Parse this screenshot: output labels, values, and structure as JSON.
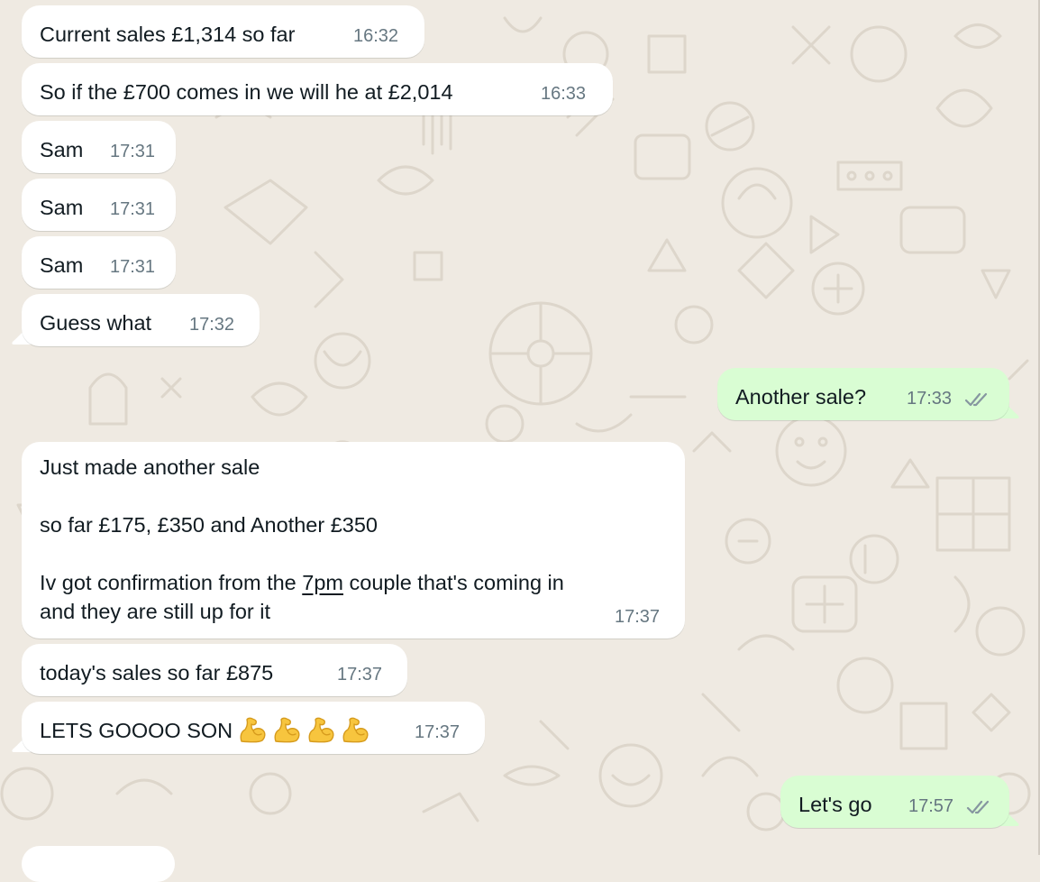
{
  "messages": [
    {
      "direction": "in",
      "text": "Current sales £1,314 so far",
      "time": "16:32"
    },
    {
      "direction": "in",
      "text": "So if the £700 comes in we will he at £2,014",
      "time": "16:33"
    },
    {
      "direction": "in",
      "text": "Sam",
      "time": "17:31"
    },
    {
      "direction": "in",
      "text": "Sam",
      "time": "17:31"
    },
    {
      "direction": "in",
      "text": "Sam",
      "time": "17:31"
    },
    {
      "direction": "in",
      "text": "Guess what",
      "time": "17:32"
    },
    {
      "direction": "out",
      "text": "Another sale?",
      "time": "17:33",
      "status": "read"
    },
    {
      "direction": "in",
      "lines": {
        "l1": "Just made another sale",
        "l2": "",
        "l3": "so far £175, £350 and Another £350",
        "l4": "",
        "l5_before": "Iv got confirmation from the ",
        "l5_link": "7pm",
        "l5_after": " couple that's coming in",
        "l6": "and they are still up for it"
      },
      "time": "17:37"
    },
    {
      "direction": "in",
      "text": "today's sales so far £875",
      "time": "17:37"
    },
    {
      "direction": "in",
      "text": "LETS GOOOO SON",
      "emoji": "flexed-biceps",
      "emoji_count": 4,
      "time": "17:37"
    },
    {
      "direction": "out",
      "text": "Let's go",
      "time": "17:57",
      "status": "read"
    }
  ],
  "colors": {
    "background": "#efeae2",
    "incoming_bubble": "#ffffff",
    "outgoing_bubble": "#d9fdd3",
    "timestamp": "#667781",
    "text": "#111b21",
    "read_ticks": "#8696a0"
  }
}
